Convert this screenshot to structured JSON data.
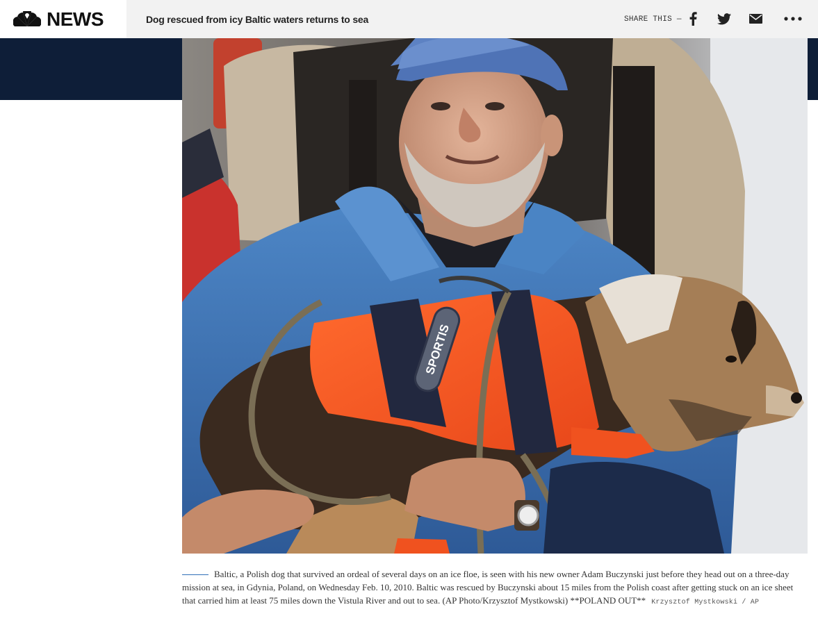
{
  "header": {
    "logo_text": "NEWS",
    "logo_icon": "nbc-peacock-icon",
    "headline": "Dog rescued from icy Baltic waters returns to sea",
    "share_label": "SHARE THIS —",
    "share_buttons": [
      {
        "icon": "facebook-icon"
      },
      {
        "icon": "twitter-icon"
      },
      {
        "icon": "email-icon"
      },
      {
        "icon": "more-icon"
      }
    ]
  },
  "colors": {
    "nav_band": "#0e1e38",
    "caption_rule": "#2f6fb8",
    "vest_orange": "#f0521f"
  },
  "photo": {
    "vest_text": "SPORTIS"
  },
  "caption": {
    "text": "Baltic, a Polish dog that survived an ordeal of several days on an ice floe, is seen with his new owner Adam Buczynski just before they head out on a three-day mission at sea, in Gdynia, Poland, on Wednesday Feb. 10, 2010. Baltic was rescued by Buczynski about 15 miles from the Polish coast after getting stuck on an ice sheet that carried him at least 75 miles down the Vistula River and out to sea. (AP Photo/Krzysztof Mystkowski) **POLAND OUT**",
    "credit": "Krzysztof Mystkowski / AP"
  }
}
